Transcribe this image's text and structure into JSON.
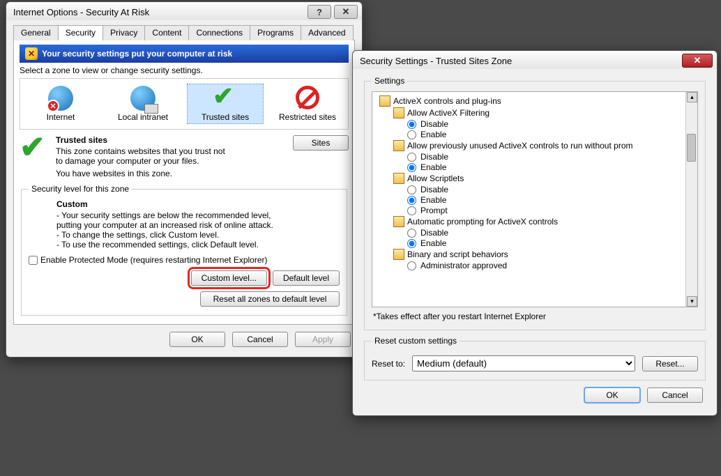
{
  "io": {
    "title": "Internet Options - Security At Risk",
    "tabs": [
      "General",
      "Security",
      "Privacy",
      "Content",
      "Connections",
      "Programs",
      "Advanced"
    ],
    "active_tab": "Security",
    "warning": "Your security settings put your computer at risk",
    "select_zone_label": "Select a zone to view or change security settings.",
    "zones": [
      {
        "label": "Internet"
      },
      {
        "label": "Local intranet"
      },
      {
        "label": "Trusted sites"
      },
      {
        "label": "Restricted sites"
      }
    ],
    "selected_zone": "Trusted sites",
    "zone_info": {
      "heading": "Trusted sites",
      "desc1": "This zone contains websites that you trust not to damage your computer or your files.",
      "desc2": "You have websites in this zone.",
      "sites_button": "Sites"
    },
    "level_group": "Security level for this zone",
    "custom": {
      "heading": "Custom",
      "line1": "- Your security settings are below the recommended level, putting your computer at an increased risk of online attack.",
      "line2": "- To change the settings, click Custom level.",
      "line3": "- To use the recommended settings, click Default level."
    },
    "protected_mode_label": "Enable Protected Mode (requires restarting Internet Explorer)",
    "protected_mode_checked": false,
    "custom_level_btn": "Custom level...",
    "default_level_btn": "Default level",
    "reset_all_btn": "Reset all zones to default level",
    "ok": "OK",
    "cancel": "Cancel",
    "apply": "Apply"
  },
  "ss": {
    "title": "Security Settings - Trusted Sites Zone",
    "settings_group": "Settings",
    "tree": [
      {
        "cat": "ActiveX controls and plug-ins",
        "items": [
          {
            "cat": "Allow ActiveX Filtering",
            "opts": [
              "Disable",
              "Enable"
            ],
            "sel": "Disable"
          },
          {
            "cat": "Allow previously unused ActiveX controls to run without prom",
            "opts": [
              "Disable",
              "Enable"
            ],
            "sel": "Enable"
          },
          {
            "cat": "Allow Scriptlets",
            "opts": [
              "Disable",
              "Enable",
              "Prompt"
            ],
            "sel": "Enable"
          },
          {
            "cat": "Automatic prompting for ActiveX controls",
            "opts": [
              "Disable",
              "Enable"
            ],
            "sel": "Enable"
          },
          {
            "cat": "Binary and script behaviors",
            "opts": [
              "Administrator approved"
            ],
            "sel": ""
          }
        ]
      }
    ],
    "footnote": "*Takes effect after you restart Internet Explorer",
    "reset_group": "Reset custom settings",
    "reset_to_label": "Reset to:",
    "reset_to_value": "Medium (default)",
    "reset_btn": "Reset...",
    "ok": "OK",
    "cancel": "Cancel"
  }
}
